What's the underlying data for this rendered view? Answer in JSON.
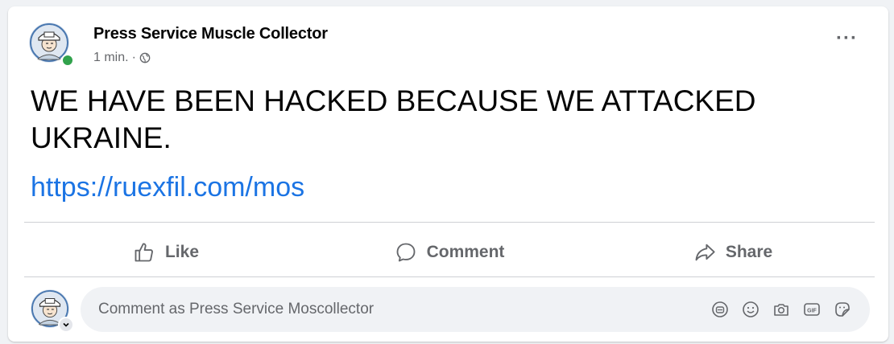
{
  "post": {
    "author": "Press Service Muscle Collector",
    "time": "1 min.",
    "separator": "·",
    "audience_icon": "globe-icon",
    "text": "WE HAVE BEEN HACKED BECAUSE WE ATTACKED UKRAINE.",
    "link": "https://ruexfil.com/mos",
    "more_icon": "more-icon",
    "more_label": "···"
  },
  "actions": [
    {
      "label": "Like",
      "icon": "thumbs-up-icon"
    },
    {
      "label": "Comment",
      "icon": "comment-bubble-icon"
    },
    {
      "label": "Share",
      "icon": "share-arrow-icon"
    }
  ],
  "comment_box": {
    "placeholder": "Comment as Press Service Moscollector",
    "icons": [
      "sticker-comment-icon",
      "emoji-icon",
      "camera-icon",
      "gif-icon",
      "sticker-icon"
    ]
  },
  "colors": {
    "link": "#1b74e4",
    "online": "#31a24c",
    "secondary_text": "#65676b",
    "background": "#f0f2f5"
  }
}
